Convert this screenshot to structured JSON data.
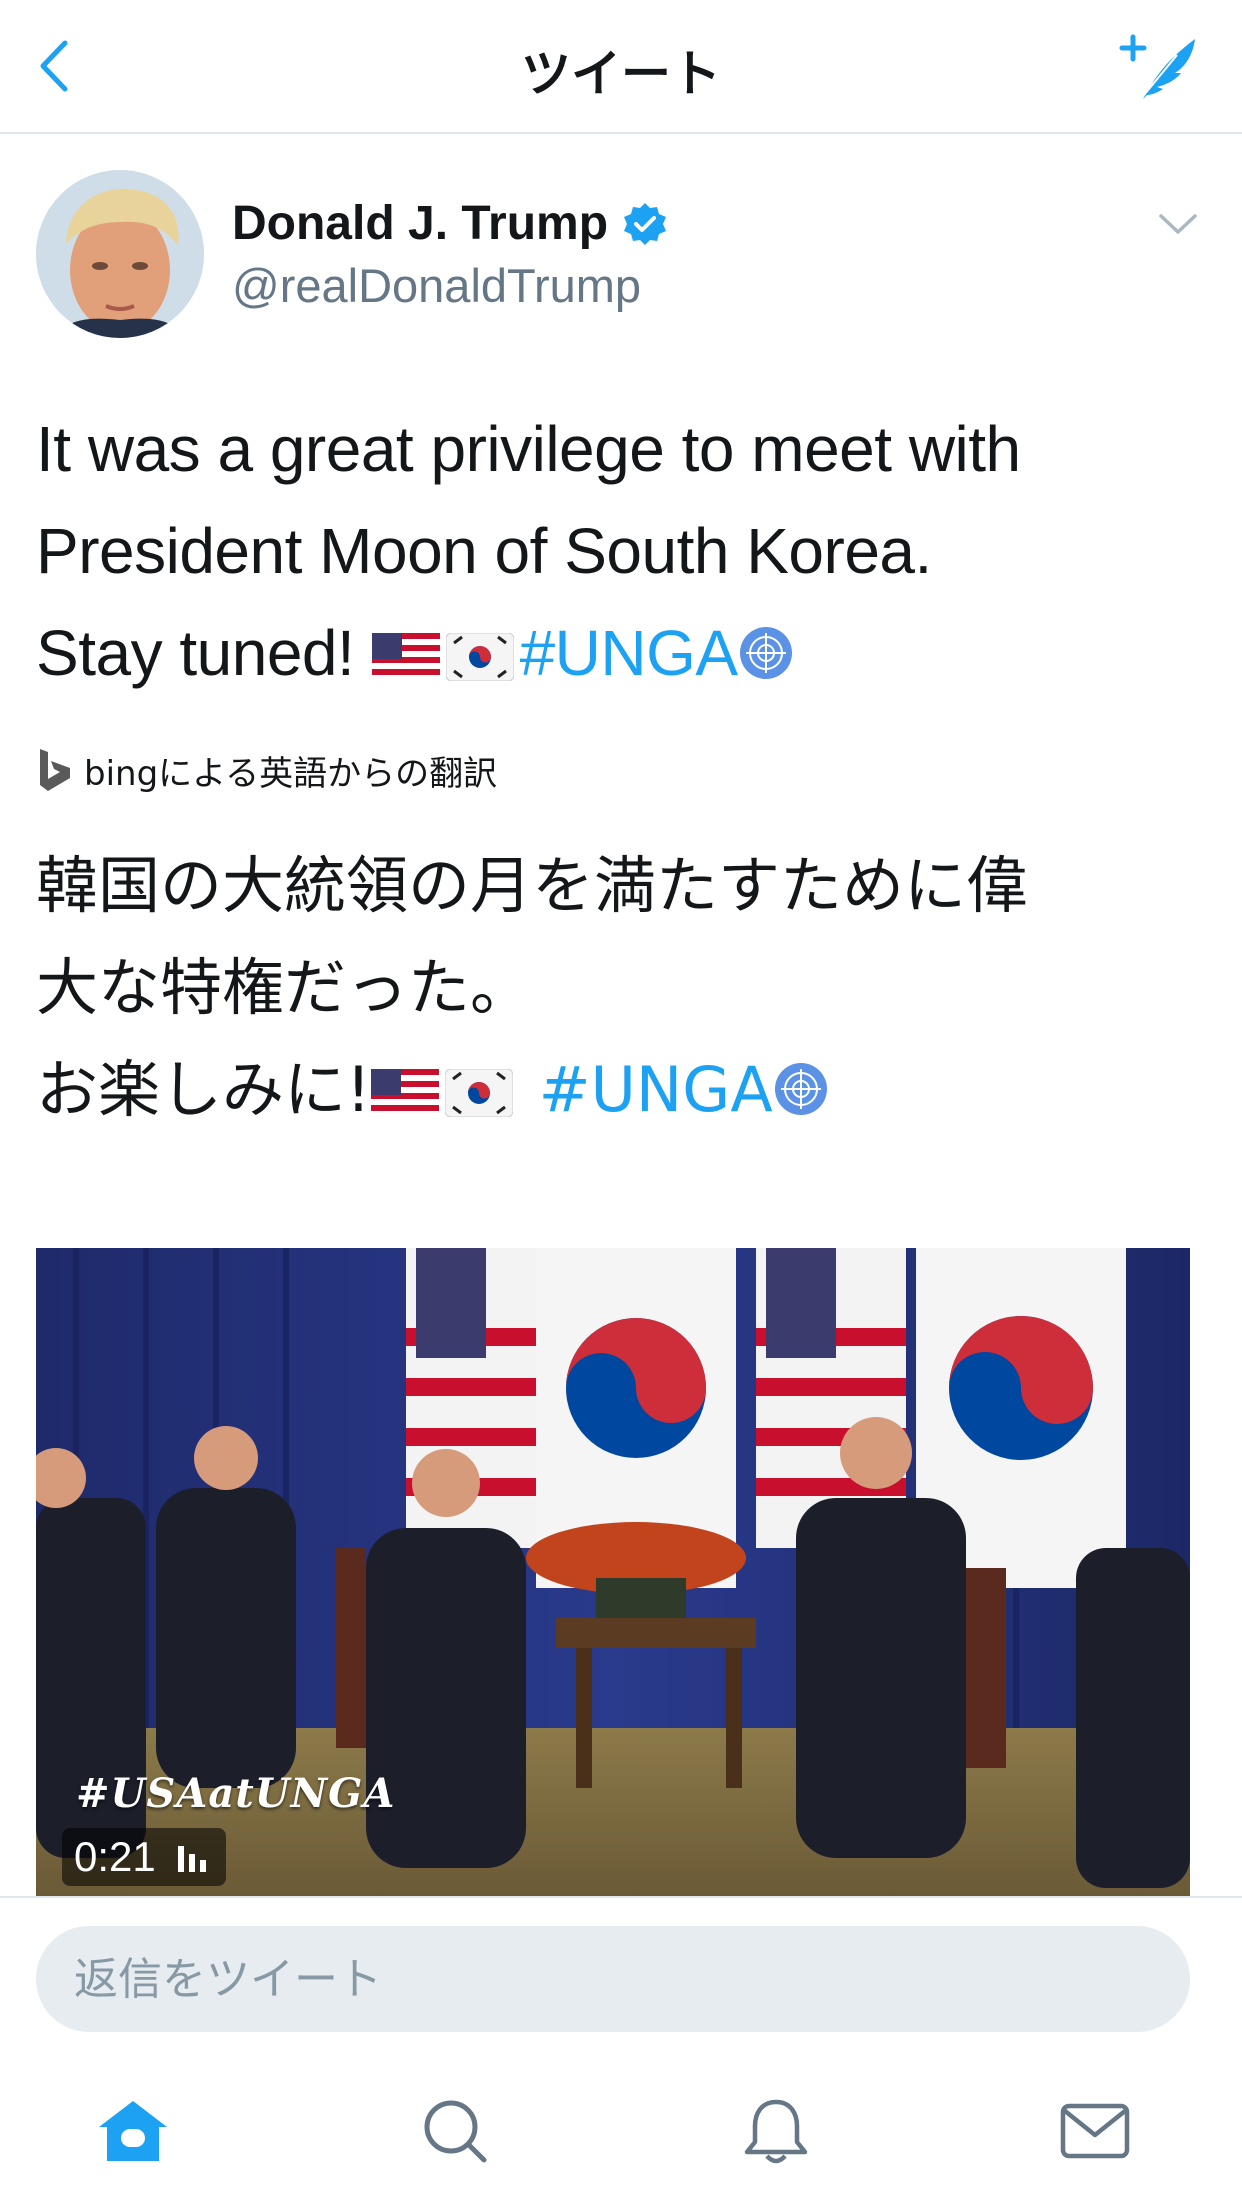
{
  "nav": {
    "title": "ツイート",
    "back_icon": "chevron-left-icon",
    "compose_icon": "compose-feather-icon"
  },
  "tweet": {
    "author": {
      "display_name": "Donald J. Trump",
      "handle": "@realDonaldTrump",
      "verified": true
    },
    "text_lines": [
      "It was a great privilege to meet with",
      "President Moon of South Korea.",
      "Stay tuned!"
    ],
    "hashtag": "#UNGA",
    "translation_label": "bingによる英語からの翻訳",
    "translated_lines": [
      "韓国の大統領の月を満たすために偉",
      "大な特権だった。",
      "お楽しみに!"
    ],
    "translated_hashtag": "#UNGA"
  },
  "media": {
    "overlay_hashtag": "#USAatUNGA",
    "duration": "0:21"
  },
  "reply": {
    "placeholder": "返信をツイート"
  },
  "tabbar": {
    "items": [
      "home-icon",
      "search-icon",
      "notifications-bell-icon",
      "messages-envelope-icon"
    ],
    "active": "home-icon"
  },
  "colors": {
    "accent": "#1da1f2",
    "text": "#14171a",
    "secondary_text": "#657786",
    "divider": "#e1e8ed",
    "input_background": "#e6ecf0"
  }
}
